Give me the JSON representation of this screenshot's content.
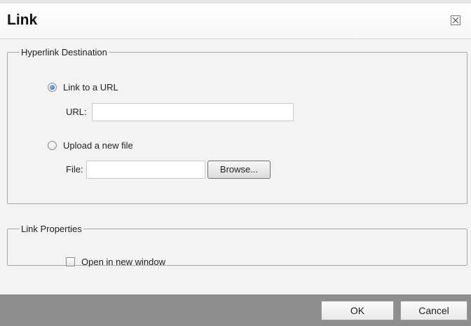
{
  "dialog": {
    "title": "Link",
    "close_icon": "close-x-box-icon"
  },
  "destination": {
    "legend": "Hyperlink Destination",
    "link_url_option": {
      "label": "Link to a URL",
      "selected": true
    },
    "url_field": {
      "label": "URL:",
      "value": ""
    },
    "upload_option": {
      "label": "Upload a new file",
      "selected": false
    },
    "file_field": {
      "label": "File:",
      "value": ""
    },
    "browse_label": "Browse..."
  },
  "properties": {
    "legend": "Link Properties",
    "new_window": {
      "label": "Open in new window",
      "checked": false
    }
  },
  "footer": {
    "ok_label": "OK",
    "cancel_label": "Cancel"
  },
  "colors": {
    "footer_bg": "#8e8e8e",
    "radio_selected": "#1c5fb5"
  }
}
